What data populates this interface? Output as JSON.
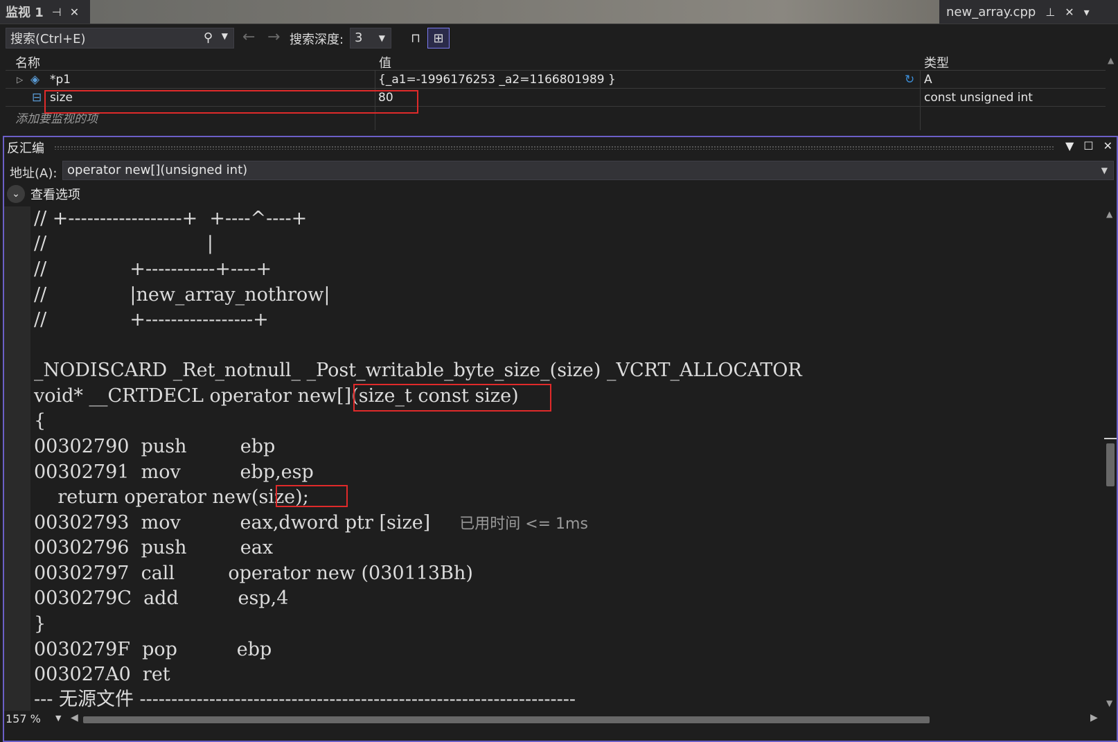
{
  "watch": {
    "tab_title": "监视 1",
    "file_tab": "new_array.cpp",
    "search_placeholder": "搜索(Ctrl+E)",
    "depth_label": "搜索深度:",
    "depth_value": "3",
    "columns": {
      "name": "名称",
      "value": "值",
      "type": "类型"
    },
    "rows": [
      {
        "name": "*p1",
        "value": "{_a1=-1996176253 _a2=1166801989 }",
        "type": "A"
      },
      {
        "name": "size",
        "value": "80",
        "type": "const unsigned int"
      }
    ],
    "add_item_placeholder": "添加要监视的项"
  },
  "disasm": {
    "title": "反汇编",
    "address_label": "地址(A):",
    "address_value": "operator new[](unsigned int)",
    "view_options_label": "查看选项",
    "zoom": "157 %",
    "lines": [
      "// +------------------+  +----^----+",
      "//                           |",
      "//              +-----------+----+",
      "//              |new_array_nothrow|",
      "//              +-----------------+",
      "",
      "_NODISCARD _Ret_notnull_ _Post_writable_byte_size_(size) _VCRT_ALLOCATOR",
      "void* __CRTDECL operator new[](size_t const size)",
      "{",
      "00302790  push         ebp",
      "00302791  mov          ebp,esp",
      "    return operator new(size);",
      "00302793  mov          eax,dword ptr [size]",
      "00302796  push         eax",
      "00302797  call         operator new (030113Bh)",
      "0030279C  add          esp,4",
      "}",
      "0030279F  pop          ebp",
      "003027A0  ret",
      "--- 无源文件 ---------------------------------------------------------------------"
    ],
    "elapsed_note": "已用时间 <= 1ms"
  }
}
